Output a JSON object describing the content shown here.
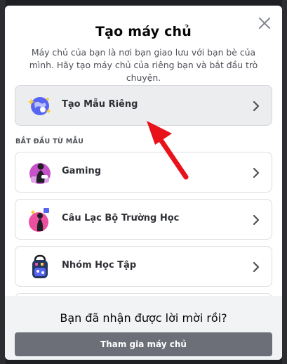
{
  "modal": {
    "title": "Tạo máy chủ",
    "subtitle": "Máy chủ của bạn là nơi bạn giao lưu với bạn bè của mình. Hãy tạo máy chủ của riêng bạn và bắt đầu trò chuyện."
  },
  "create_own": {
    "label": "Tạo Mẫu Riêng",
    "icon": "globe-icon"
  },
  "templates_section": {
    "label": "BẮT ĐẦU TỪ MẪU",
    "items": [
      {
        "label": "Gaming",
        "icon": "gaming-icon"
      },
      {
        "label": "Câu Lạc Bộ Trường Học",
        "icon": "school-club-icon"
      },
      {
        "label": "Nhóm Học Tập",
        "icon": "study-group-icon"
      }
    ]
  },
  "footer": {
    "prompt": "Bạn đã nhận được lời mời rồi?",
    "join_label": "Tham gia máy chủ"
  },
  "colors": {
    "accent_button": "#6d6f78",
    "annotation_arrow": "#e8121b",
    "modal_bg": "#ffffff",
    "footer_bg": "#f2f3f5"
  }
}
